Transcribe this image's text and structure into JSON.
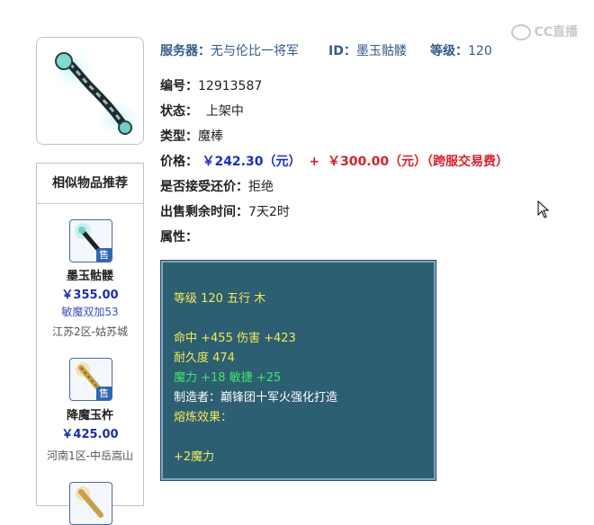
{
  "watermark": {
    "text": "CC直播"
  },
  "item": {
    "server_label": "服务器：",
    "server_value": "无与伦比一将军",
    "id_label": "ID：",
    "id_value": "墨玉骷髅",
    "level_label": "等级：",
    "level_value": "120",
    "number_label": "编号：",
    "number_value": "12913587",
    "status_label": "状态：",
    "status_value": "上架中",
    "type_label": "类型：",
    "type_value": "魔棒",
    "price_label": "价格：",
    "price_main": "￥242.30（元）",
    "price_plus": "+",
    "price_fee": "￥300.00（元）（跨服交易费）",
    "counter_label": "是否接受还价：",
    "counter_value": "拒绝",
    "remaining_label": "出售剩余时间：",
    "remaining_value": "7天2时",
    "attr_label": "属性："
  },
  "attributes": {
    "line1": "等级 120 五行 木",
    "line2": "命中 +455 伤害 +423",
    "line3": "耐久度 474",
    "line4": "魔力 +18 敏捷 +25",
    "line5": "制造者：巅锋团十军火强化打造",
    "line6": "熔炼效果：",
    "line7": "+2魔力"
  },
  "sidebar": {
    "title": "相似物品推荐",
    "items": [
      {
        "badge": "售",
        "name": "墨玉骷髅",
        "price": "￥355.00",
        "extra": "敏魔双加53",
        "location": "江苏2区-姑苏城"
      },
      {
        "badge": "售",
        "name": "降魔玉杵",
        "price": "￥425.00",
        "extra": "",
        "location": "河南1区-中岳嵩山"
      }
    ]
  },
  "colors": {
    "header_blue": "#345a8a",
    "price_blue": "#1a2fc8",
    "price_red": "#d8202b",
    "attr_bg": "#2d5f72",
    "attr_yellow": "#f3e85a",
    "attr_green": "#3ee56a"
  }
}
